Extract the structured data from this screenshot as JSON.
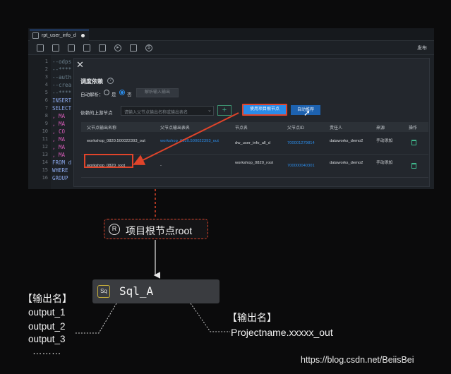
{
  "ide": {
    "tab_label": "rpt_user_info_d",
    "publish_label": "发布",
    "line_numbers": [
      "1",
      "2",
      "3",
      "4",
      "5",
      "6",
      "7",
      "8",
      "9",
      "10",
      "11",
      "12",
      "13",
      "14",
      "15",
      "16"
    ],
    "visible_line_numbers": [
      "14",
      "15",
      "16"
    ],
    "code": {
      "l1": "--odps",
      "l2": "--****",
      "l3": "--auth",
      "l4": "--crea",
      "l5": "--****",
      "l6": "INSERT",
      "l7": "SELECT",
      "l8": ", MA",
      "l9": ", MA",
      "l10": ", CO",
      "l11": ", MA",
      "l12": ", MA",
      "l13": ", MA",
      "l14": "FROM d",
      "l15": "WHERE",
      "l16": "GROUP"
    }
  },
  "dialog": {
    "title": "调度依赖",
    "auto_parse_label": "自动解析：",
    "radio_yes": "是",
    "radio_no": "否",
    "parse_button": "解析输入输出",
    "upstream_label": "依赖的上游节点",
    "upstream_placeholder": "请输入父节点输出名称或输出表名",
    "add_button": "+",
    "use_root_button": "使用项目根节点",
    "auto_recommend_button": "自动推荐",
    "columns": [
      "父节点输出名称",
      "父节点输出表名",
      "节点名",
      "父节点ID",
      "责任人",
      "来源",
      "操作"
    ],
    "rows": [
      {
        "output_name": "workshop_0820.500022393_out",
        "table_name": "workshop_0820.500022393_out",
        "node_name": "dw_user_info_all_d",
        "node_id": "700001279814",
        "owner": "dataworks_demo2",
        "source": "手动添加"
      },
      {
        "output_name": "workshop_0820_root",
        "table_name": "-",
        "node_name": "workshop_0820_root",
        "node_id": "700000040301",
        "owner": "dataworks_demo2",
        "source": "手动添加"
      }
    ]
  },
  "diagram": {
    "root_icon": "R",
    "root_label": "项目根节点root",
    "sql_icon": "Sq",
    "sql_label": "Sql_A",
    "output_title": "【输出名】",
    "outputs": [
      "output_1",
      "output_2",
      "output_3",
      "………"
    ],
    "project_output_title": "【输出名】",
    "project_output": "Projectname.xxxxx_out"
  },
  "watermark": "https://blog.csdn.net/BeiisBei",
  "colors": {
    "accent_blue": "#2a8be8",
    "highlight_red": "#e0442a",
    "green": "#3fb68b"
  }
}
